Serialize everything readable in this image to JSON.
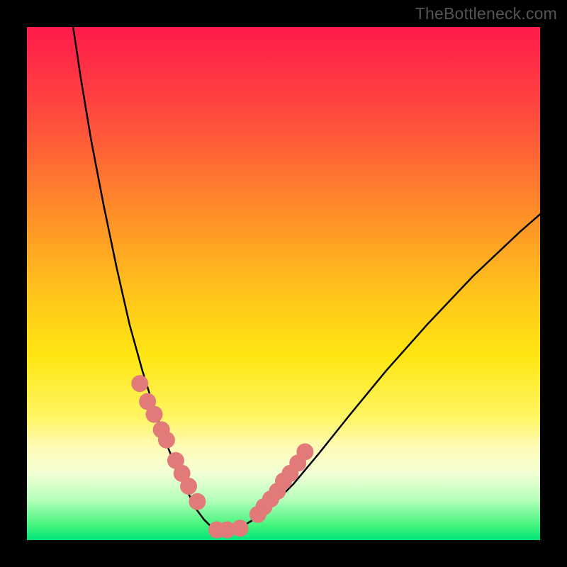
{
  "attribution": "TheBottleneck.com",
  "chart_data": {
    "type": "line",
    "title": "",
    "subtitle": "",
    "xlabel": "",
    "ylabel": "",
    "xlim": [
      0,
      100
    ],
    "ylim": [
      0,
      100
    ],
    "grid": false,
    "legend_position": "none",
    "series": [
      {
        "name": "bottleneck-curve-left",
        "stroke": "#000000",
        "stroke_width": 2.5,
        "x": [
          9.0,
          10.5,
          12.5,
          15.0,
          17.5,
          20.0,
          22.5,
          25.0,
          27.5,
          30.0,
          31.5,
          33.0,
          34.5,
          36.0,
          37.5
        ],
        "y": [
          100.0,
          90.0,
          78.0,
          65.0,
          53.0,
          42.0,
          33.0,
          25.0,
          18.0,
          12.0,
          9.0,
          6.0,
          4.0,
          2.5,
          1.5
        ]
      },
      {
        "name": "bottleneck-curve-right",
        "stroke": "#000000",
        "stroke_width": 2.5,
        "x": [
          37.5,
          40.0,
          42.5,
          45.0,
          48.0,
          52.0,
          57.0,
          63.0,
          70.0,
          78.0,
          87.0,
          96.0,
          100.0
        ],
        "y": [
          1.5,
          2.0,
          3.0,
          4.5,
          7.0,
          11.0,
          17.0,
          24.5,
          33.0,
          42.0,
          51.5,
          60.0,
          63.5
        ]
      },
      {
        "name": "salmon-beads",
        "type": "scatter",
        "marker": "circle",
        "marker_color": "#e17a78",
        "marker_radius": 12,
        "x": [
          22.0,
          23.5,
          24.8,
          26.2,
          27.2,
          29.0,
          30.2,
          31.5,
          33.2,
          37.0,
          39.0,
          41.5,
          45.0,
          46.2,
          47.5,
          48.8,
          50.0,
          51.3,
          52.8,
          54.2
        ],
        "y": [
          30.5,
          27.0,
          24.5,
          21.5,
          19.5,
          15.5,
          13.0,
          10.5,
          7.5,
          2.0,
          2.0,
          2.3,
          5.0,
          6.5,
          8.0,
          9.5,
          11.5,
          13.0,
          15.0,
          17.2
        ]
      }
    ],
    "background_gradient": {
      "type": "vertical",
      "stops": [
        {
          "pos": 0.0,
          "color": "#ff1a4b"
        },
        {
          "pos": 0.17,
          "color": "#ff4a3e"
        },
        {
          "pos": 0.35,
          "color": "#ff8a2a"
        },
        {
          "pos": 0.52,
          "color": "#ffc41b"
        },
        {
          "pos": 0.64,
          "color": "#ffe612"
        },
        {
          "pos": 0.76,
          "color": "#fff563"
        },
        {
          "pos": 0.82,
          "color": "#fffbb8"
        },
        {
          "pos": 0.87,
          "color": "#f2ffd4"
        },
        {
          "pos": 0.92,
          "color": "#b8ffbc"
        },
        {
          "pos": 0.97,
          "color": "#46f57e"
        },
        {
          "pos": 1.0,
          "color": "#00e47a"
        }
      ]
    }
  }
}
